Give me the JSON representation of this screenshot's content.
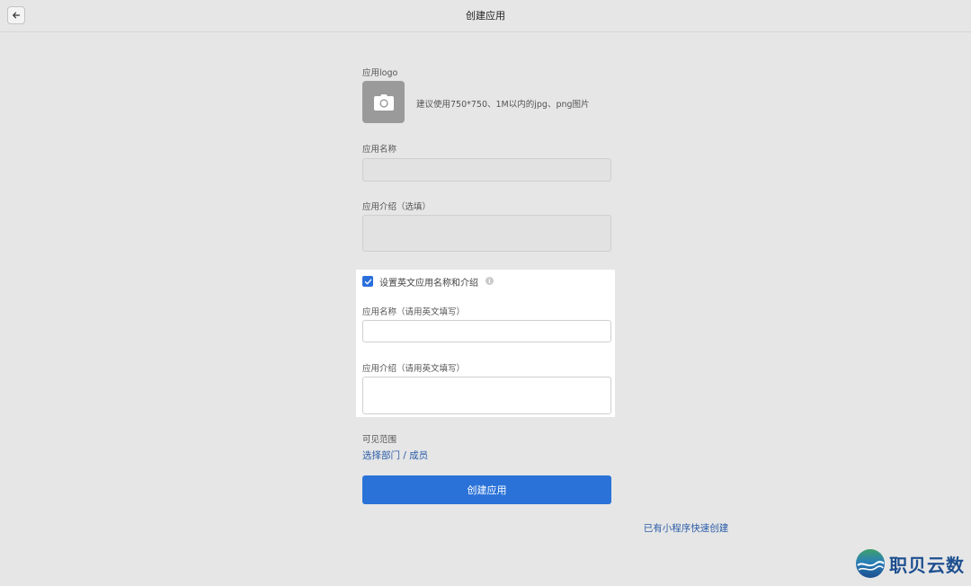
{
  "header": {
    "title": "创建应用"
  },
  "logo": {
    "label": "应用logo",
    "hint": "建议使用750*750、1M以内的jpg、png图片"
  },
  "app_name": {
    "label": "应用名称",
    "value": ""
  },
  "app_intro": {
    "label": "应用介绍（选填）",
    "value": ""
  },
  "english": {
    "checkbox_label": "设置英文应用名称和介绍",
    "checked": true,
    "name_label": "应用名称（请用英文填写）",
    "name_value": "",
    "intro_label": "应用介绍（请用英文填写）",
    "intro_value": ""
  },
  "visibility": {
    "label": "可见范围",
    "link": "选择部门 / 成员"
  },
  "actions": {
    "create_label": "创建应用",
    "quick_create_label": "已有小程序快速创建"
  },
  "watermark": {
    "text": "职贝云数"
  },
  "colors": {
    "primary": "#2a72d8",
    "link": "#2b5da8",
    "background": "#e6e6e6"
  }
}
